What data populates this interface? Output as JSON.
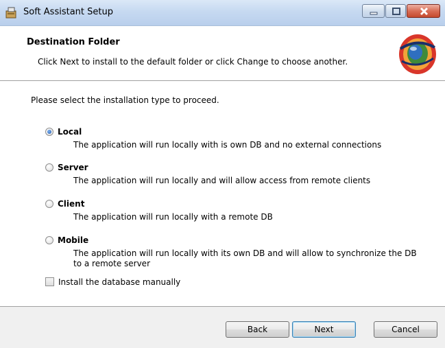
{
  "window": {
    "title": "Soft Assistant Setup",
    "icons": [
      "installer-icon",
      "minimize-icon",
      "maximize-icon",
      "close-icon"
    ]
  },
  "header": {
    "title": "Destination Folder",
    "subtitle": "Click Next to install to the default folder or click Change to choose another.",
    "logo_icon": "globe-logo-icon"
  },
  "main": {
    "prompt": "Please select the installation type to proceed.",
    "options": [
      {
        "label": "Local",
        "description": "The application will run locally with is own DB and no external connections",
        "selected": true
      },
      {
        "label": "Server",
        "description": "The application will run locally and will allow access from remote clients",
        "selected": false
      },
      {
        "label": "Client",
        "description": "The application will run locally with a remote DB",
        "selected": false
      },
      {
        "label": "Mobile",
        "description": "The application will run locally with its own DB and will allow to synchronize the DB to a remote server",
        "selected": false
      }
    ],
    "manual_db": {
      "label": "Install the database manually",
      "checked": false
    }
  },
  "footer": {
    "back_label": "Back",
    "next_label": "Next",
    "cancel_label": "Cancel"
  },
  "colors": {
    "titlebar": "#c6d9f1",
    "footer": "#f0f0f0",
    "close_button": "#d96e57",
    "default_button_border": "#3c7fb1"
  }
}
